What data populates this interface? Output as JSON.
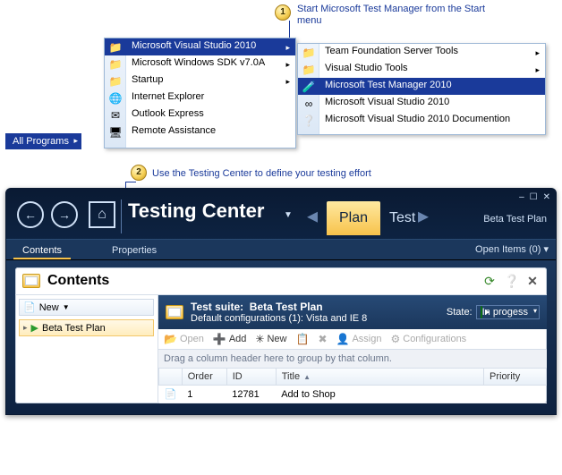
{
  "callouts": {
    "c1_num": "1",
    "c1_text": "Start Microsoft Test Manager from the Start menu",
    "c2_num": "2",
    "c2_text": "Use the Testing Center to define your testing effort"
  },
  "all_programs": "All Programs",
  "menu1": {
    "items": [
      {
        "label": "Microsoft Visual Studio 2010",
        "arrow": true,
        "selected": true,
        "icon": "📁"
      },
      {
        "label": "Microsoft Windows SDK v7.0A",
        "arrow": true,
        "icon": "📁"
      },
      {
        "label": "Startup",
        "arrow": true,
        "icon": "📁"
      },
      {
        "label": "Internet Explorer",
        "icon": "🌐"
      },
      {
        "label": "Outlook Express",
        "icon": "✉"
      },
      {
        "label": "Remote Assistance",
        "icon": "🖥"
      }
    ]
  },
  "menu2": {
    "items": [
      {
        "label": "Team Foundation Server Tools",
        "arrow": true,
        "icon": "📁"
      },
      {
        "label": "Visual Studio Tools",
        "arrow": true,
        "icon": "📁"
      },
      {
        "label": "Microsoft Test Manager 2010",
        "selected": true,
        "icon": "🧪"
      },
      {
        "label": "Microsoft Visual Studio 2010",
        "icon": "∞"
      },
      {
        "label": "Microsoft Visual Studio 2010 Documention",
        "icon": "❔"
      }
    ]
  },
  "app": {
    "title": "Testing Center",
    "tabs": {
      "plan": "Plan",
      "test": "Test"
    },
    "plan_label": "Beta Test Plan",
    "win_min": "–",
    "win_max": "☐",
    "win_close": "✕",
    "subnav": {
      "contents": "Contents",
      "properties": "Properties",
      "open_items": "Open Items (0)"
    },
    "contents_heading": "Contents",
    "tree": {
      "new": "New",
      "root": "Beta Test Plan"
    },
    "suite": {
      "prefix": "Test suite:",
      "name": "Beta Test Plan",
      "config": "Default configurations (1): Vista and IE 8",
      "state_label": "State:",
      "state_value": "In progess"
    },
    "toolbar": {
      "open": "Open",
      "add": "Add",
      "new": "New",
      "assign": "Assign",
      "configurations": "Configurations"
    },
    "group_hint": "Drag a column header here to group by that column.",
    "columns": {
      "order": "Order",
      "id": "ID",
      "title": "Title",
      "priority": "Priority"
    },
    "rows": [
      {
        "order": "1",
        "id": "12781",
        "title": "Add to Shop",
        "priority": ""
      }
    ]
  }
}
